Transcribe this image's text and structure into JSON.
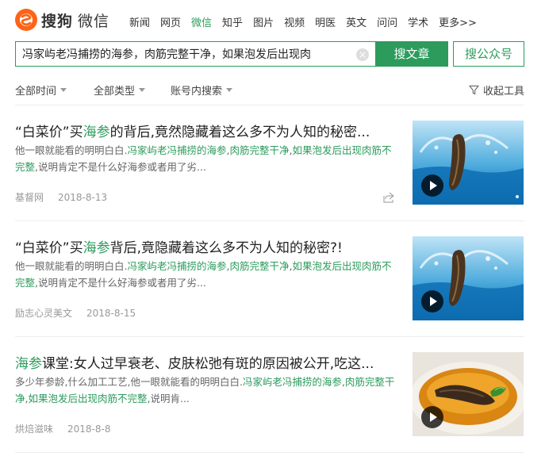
{
  "logo": {
    "brand": "搜狗",
    "product": "微信"
  },
  "nav": [
    "新闻",
    "网页",
    "微信",
    "知乎",
    "图片",
    "视频",
    "明医",
    "英文",
    "问问",
    "学术",
    "更多>>"
  ],
  "nav_active": "微信",
  "search": {
    "query": "冯家屿老冯捕捞的海参，肉筋完整干净，如果泡发后出现肉",
    "search_articles_label": "搜文章",
    "search_accounts_label": "搜公众号"
  },
  "filters": {
    "time": "全部时间",
    "type": "全部类型",
    "account": "账号内搜索",
    "collapse": "收起工具"
  },
  "colors": {
    "accent": "#2c9b5c",
    "text": "#222222",
    "muted": "#999999"
  },
  "icons": {
    "logo": "sogou-logo-icon",
    "funnel": "funnel-icon",
    "share": "share-icon",
    "play": "play-icon",
    "clear": "clear-icon"
  },
  "results": [
    {
      "title": {
        "pre": "“白菜价”买",
        "hl": "海参",
        "post": "的背后,竟然隐藏着这么多不为人知的秘密..."
      },
      "snippet": [
        {
          "text": "他一眼就能看的明明白白.",
          "hl": false
        },
        {
          "text": "冯家屿老冯捕捞的海参",
          "hl": true
        },
        {
          "text": ",",
          "hl": false
        },
        {
          "text": "肉筋完整干净",
          "hl": true
        },
        {
          "text": ",",
          "hl": false
        },
        {
          "text": "如果泡发后出现肉筋不完整",
          "hl": true
        },
        {
          "text": ",说明肯定不是什么好海参或者用了劣...",
          "hl": false
        }
      ],
      "source": "基督网",
      "date": "2018-8-13",
      "has_share": true
    },
    {
      "title": {
        "pre": "“白菜价”买",
        "hl": "海参",
        "post": "背后,竟隐藏着这么多不为人知的秘密?!"
      },
      "snippet": [
        {
          "text": "他一眼就能看的明明白白.",
          "hl": false
        },
        {
          "text": "冯家屿老冯捕捞的海参",
          "hl": true
        },
        {
          "text": ",",
          "hl": false
        },
        {
          "text": "肉筋完整干净",
          "hl": true
        },
        {
          "text": ",",
          "hl": false
        },
        {
          "text": "如果泡发后出现肉筋不完整",
          "hl": true
        },
        {
          "text": ",说明肯定不是什么好海参或者用了劣...",
          "hl": false
        }
      ],
      "source": "励志心灵美文",
      "date": "2018-8-15",
      "has_share": false
    },
    {
      "title": {
        "pre": "",
        "hl": "海参",
        "post": "课堂:女人过早衰老、皮肤松弛有斑的原因被公开,吃这..."
      },
      "snippet": [
        {
          "text": "多少年参龄,什么加工工艺,他一眼就能看的明明白白.",
          "hl": false
        },
        {
          "text": "冯家屿老冯捕捞的海参",
          "hl": true
        },
        {
          "text": ",",
          "hl": false
        },
        {
          "text": "肉筋完整干净",
          "hl": true
        },
        {
          "text": ",",
          "hl": false
        },
        {
          "text": "如果泡发后出现肉筋不完整",
          "hl": true
        },
        {
          "text": ",说明肯...",
          "hl": false
        }
      ],
      "source": "烘焙滋味",
      "date": "2018-8-8",
      "has_share": false
    }
  ]
}
